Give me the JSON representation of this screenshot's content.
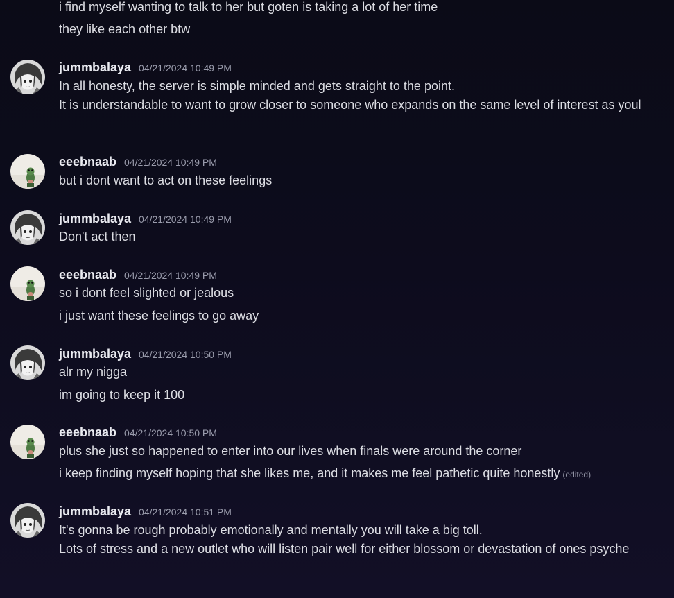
{
  "top_lines": [
    "i find myself wanting to talk to her but goten is taking a lot of her time",
    "they like each other btw"
  ],
  "messages": [
    {
      "username": "jummbalaya",
      "timestamp": "04/21/2024 10:49 PM",
      "lines": [
        "In all honesty, the server is simple minded and gets straight to the point.",
        "It is understandable to want to grow closer to someone who expands on the same level of interest as youl"
      ]
    },
    {
      "username": "eeebnaab",
      "timestamp": "04/21/2024 10:49 PM",
      "lines": [
        "but i dont want to act on these feelings"
      ]
    },
    {
      "username": "jummbalaya",
      "timestamp": "04/21/2024 10:49 PM",
      "lines": [
        "Don't act then"
      ]
    },
    {
      "username": "eeebnaab",
      "timestamp": "04/21/2024 10:49 PM",
      "lines": [
        "so i dont feel slighted or jealous",
        "i just want these feelings to go away"
      ]
    },
    {
      "username": "jummbalaya",
      "timestamp": "04/21/2024 10:50 PM",
      "lines": [
        "alr my nigga",
        "im going to keep it 100"
      ]
    },
    {
      "username": "eeebnaab",
      "timestamp": "04/21/2024 10:50 PM",
      "lines": [
        "plus she just so happened to enter into our lives when finals were around the corner",
        "i keep finding myself hoping that she likes me, and it makes me feel pathetic quite honestly"
      ],
      "edited_label": "(edited)"
    },
    {
      "username": "jummbalaya",
      "timestamp": "04/21/2024 10:51 PM",
      "lines": [
        "It's gonna be rough probably emotionally and mentally you will take a big toll.",
        "Lots of stress and a new outlet who will listen pair well for either blossom or devastation of ones psyche"
      ]
    }
  ],
  "avatars": {
    "jummbalaya": "manga-portrait-avatar",
    "eeebnaab": "frog-figure-avatar"
  },
  "colors": {
    "background_top": "#0b0b17",
    "background_bottom": "#120f26",
    "text": "#dcdde3",
    "username": "#e9eaf0",
    "timestamp": "#9a9cac"
  }
}
